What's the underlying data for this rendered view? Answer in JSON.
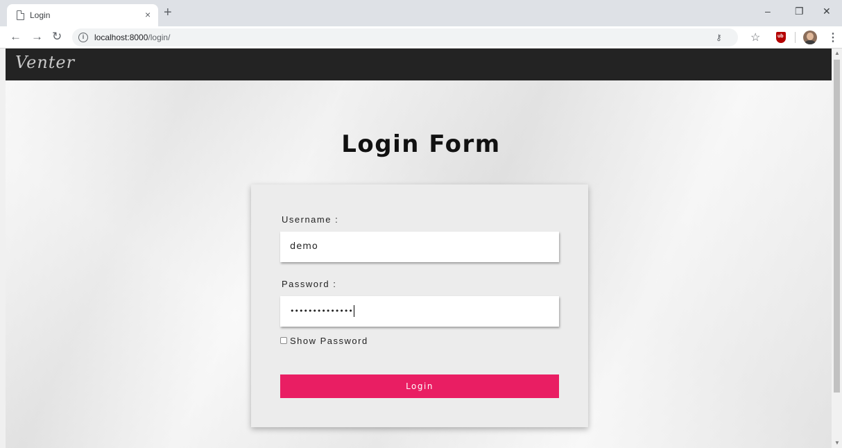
{
  "browser": {
    "tab_title": "Login",
    "tab_close": "×",
    "new_tab": "+",
    "url_host": "localhost:8000",
    "url_path": "/login/",
    "window_minimize": "–",
    "window_restore": "❐",
    "window_close": "✕"
  },
  "site": {
    "brand": "Venter"
  },
  "login": {
    "title": "Login Form",
    "username_label": "Username :",
    "username_value": "demo",
    "password_label": "Password :",
    "password_mask": "••••••••••••••",
    "show_password_label": "Show Password",
    "submit_label": "Login"
  },
  "colors": {
    "accent": "#e91e63",
    "navbar": "#232323"
  }
}
